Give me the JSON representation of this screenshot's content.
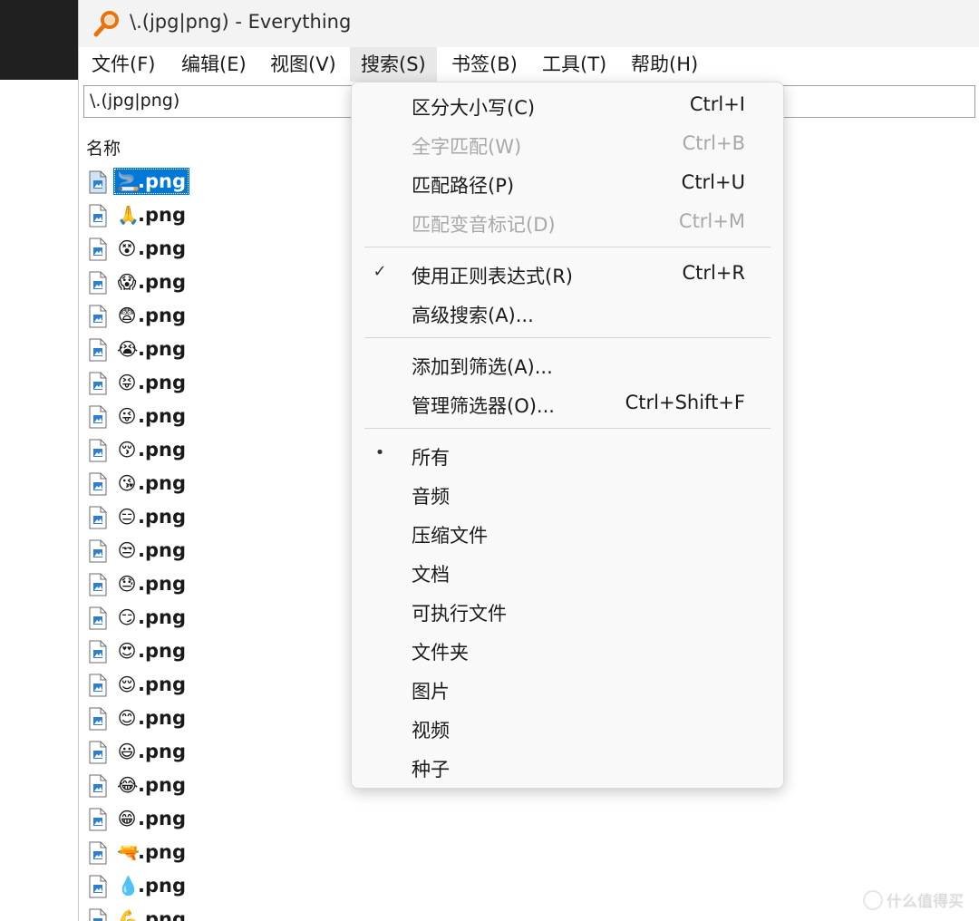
{
  "window": {
    "title": "\\.(jpg|png) - Everything"
  },
  "menubar": [
    {
      "label": "文件(F)"
    },
    {
      "label": "编辑(E)"
    },
    {
      "label": "视图(V)"
    },
    {
      "label": "搜索(S)"
    },
    {
      "label": "书签(B)"
    },
    {
      "label": "工具(T)"
    },
    {
      "label": "帮助(H)"
    }
  ],
  "search": {
    "value": "\\.(jpg|png)"
  },
  "list_header": {
    "name": "名称"
  },
  "files": [
    {
      "emoji": "🚬",
      "ext": ".png"
    },
    {
      "emoji": "🙏",
      "ext": ".png"
    },
    {
      "emoji": "😵",
      "ext": ".png"
    },
    {
      "emoji": "😱",
      "ext": ".png"
    },
    {
      "emoji": "😨",
      "ext": ".png"
    },
    {
      "emoji": "😭",
      "ext": ".png"
    },
    {
      "emoji": "😝",
      "ext": ".png"
    },
    {
      "emoji": "😜",
      "ext": ".png"
    },
    {
      "emoji": "😚",
      "ext": ".png"
    },
    {
      "emoji": "😘",
      "ext": ".png"
    },
    {
      "emoji": "😑",
      "ext": ".png"
    },
    {
      "emoji": "😒",
      "ext": ".png"
    },
    {
      "emoji": "😓",
      "ext": ".png"
    },
    {
      "emoji": "😏",
      "ext": ".png"
    },
    {
      "emoji": "😍",
      "ext": ".png"
    },
    {
      "emoji": "😌",
      "ext": ".png"
    },
    {
      "emoji": "😊",
      "ext": ".png"
    },
    {
      "emoji": "😃",
      "ext": ".png"
    },
    {
      "emoji": "😂",
      "ext": ".png"
    },
    {
      "emoji": "😁",
      "ext": ".png"
    },
    {
      "emoji": "🔫",
      "ext": ".png"
    },
    {
      "emoji": "💧",
      "ext": ".png"
    },
    {
      "emoji": "💪",
      "ext": ".png"
    }
  ],
  "dropdown": {
    "group1": [
      {
        "label": "区分大小写(C)",
        "shortcut": "Ctrl+I",
        "disabled": false
      },
      {
        "label": "全字匹配(W)",
        "shortcut": "Ctrl+B",
        "disabled": true
      },
      {
        "label": "匹配路径(P)",
        "shortcut": "Ctrl+U",
        "disabled": false
      },
      {
        "label": "匹配变音标记(D)",
        "shortcut": "Ctrl+M",
        "disabled": true
      }
    ],
    "group2": [
      {
        "label": "使用正则表达式(R)",
        "shortcut": "Ctrl+R",
        "check": "✓"
      },
      {
        "label": "高级搜索(A)...",
        "shortcut": ""
      }
    ],
    "group3": [
      {
        "label": "添加到筛选(A)...",
        "shortcut": ""
      },
      {
        "label": "管理筛选器(O)...",
        "shortcut": "Ctrl+Shift+F"
      }
    ],
    "filters": [
      {
        "label": "所有",
        "check": "•"
      },
      {
        "label": "音频",
        "check": ""
      },
      {
        "label": "压缩文件",
        "check": ""
      },
      {
        "label": "文档",
        "check": ""
      },
      {
        "label": "可执行文件",
        "check": ""
      },
      {
        "label": "文件夹",
        "check": ""
      },
      {
        "label": "图片",
        "check": ""
      },
      {
        "label": "视频",
        "check": ""
      },
      {
        "label": "种子",
        "check": ""
      }
    ]
  },
  "watermark": {
    "text": "什么值得买"
  },
  "colors": {
    "selection": "#0078d7",
    "menu_bg": "#f9f9f9",
    "disabled_text": "#a8a8a8"
  }
}
